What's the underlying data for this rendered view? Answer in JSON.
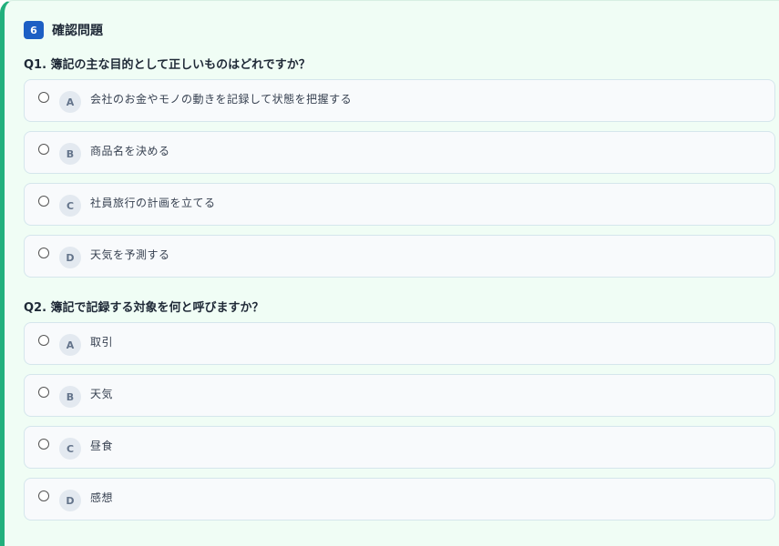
{
  "section": {
    "number": "6",
    "title": "確認問題"
  },
  "questions": [
    {
      "text": "Q1. 簿記の主な目的として正しいものはどれですか？",
      "options": [
        {
          "letter": "A",
          "text": "会社のお金やモノの動きを記録して状態を把握する"
        },
        {
          "letter": "B",
          "text": "商品名を決める"
        },
        {
          "letter": "C",
          "text": "社員旅行の計画を立てる"
        },
        {
          "letter": "D",
          "text": "天気を予測する"
        }
      ]
    },
    {
      "text": "Q2. 簿記で記録する対象を何と呼びますか？",
      "options": [
        {
          "letter": "A",
          "text": "取引"
        },
        {
          "letter": "B",
          "text": "天気"
        },
        {
          "letter": "C",
          "text": "昼食"
        },
        {
          "letter": "D",
          "text": "感想"
        }
      ]
    }
  ]
}
